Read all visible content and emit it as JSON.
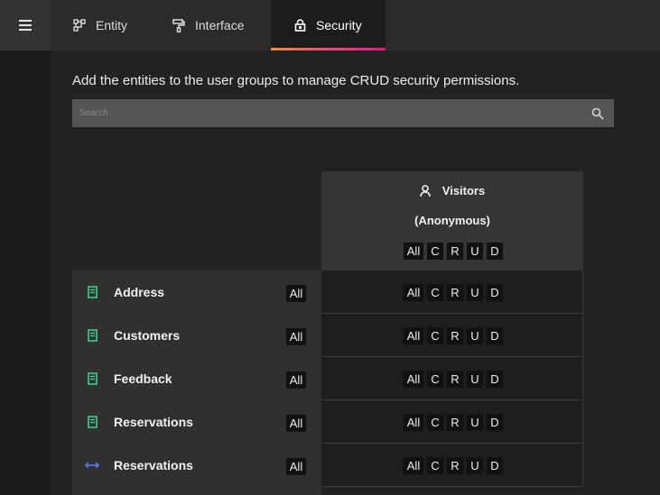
{
  "tabs": [
    {
      "label": "Entity",
      "icon": "entity-diagram-icon"
    },
    {
      "label": "Interface",
      "icon": "paint-roller-icon"
    },
    {
      "label": "Security",
      "icon": "lock-icon",
      "active": true
    }
  ],
  "description": "Add the entities to the user groups to manage CRUD security permissions.",
  "search": {
    "placeholder": "Search"
  },
  "group": {
    "name": "Visitors",
    "subtitle": "(Anonymous)"
  },
  "crud_labels": {
    "all": "All",
    "c": "C",
    "r": "R",
    "u": "U",
    "d": "D"
  },
  "entities": [
    {
      "name": "Address",
      "icon": "table-icon",
      "all_label": "All"
    },
    {
      "name": "Customers",
      "icon": "table-icon",
      "all_label": "All"
    },
    {
      "name": "Feedback",
      "icon": "table-icon",
      "all_label": "All"
    },
    {
      "name": "Reservations",
      "icon": "table-icon",
      "all_label": "All"
    },
    {
      "name": "Reservations",
      "icon": "relation-icon",
      "all_label": "All"
    }
  ],
  "colors": {
    "accent_gradient_start": "#ef8b3a",
    "accent_gradient_end": "#e3187c",
    "table_icon": "#3ecf8e",
    "relation_icon": "#5b7cff"
  }
}
